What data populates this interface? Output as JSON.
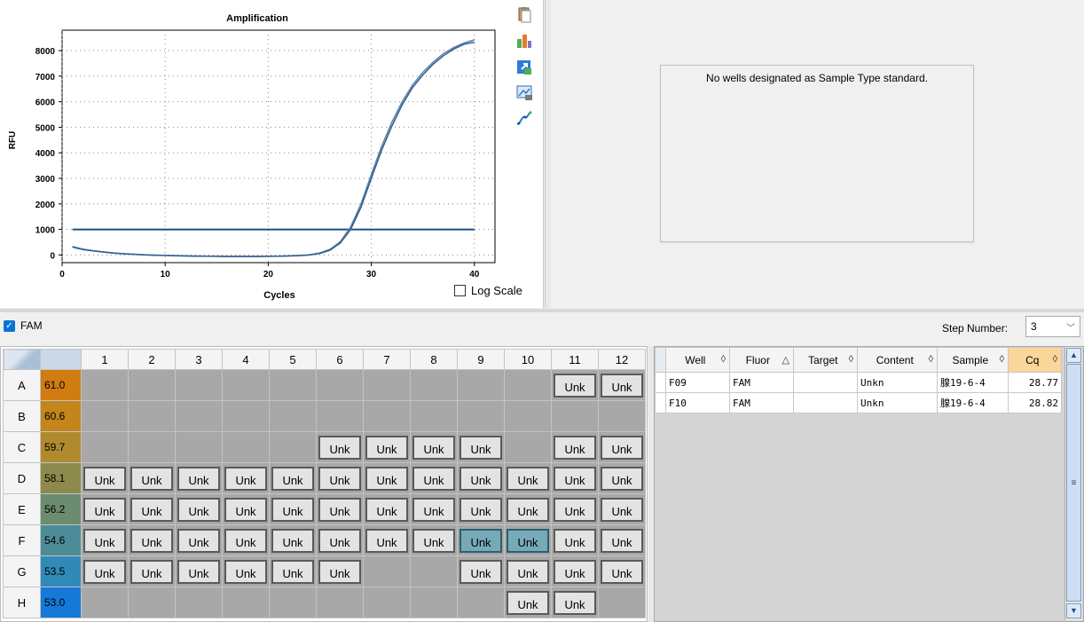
{
  "chart_data": {
    "type": "line",
    "title": "Amplification",
    "xlabel": "Cycles",
    "ylabel": "RFU",
    "xlim": [
      0,
      42
    ],
    "ylim": [
      -300,
      8800
    ],
    "xticks": [
      0,
      10,
      20,
      30,
      40
    ],
    "yticks": [
      0,
      1000,
      2000,
      3000,
      4000,
      5000,
      6000,
      7000,
      8000
    ],
    "grid": true,
    "series": [
      {
        "color": "#5b7fa8",
        "x": [
          1,
          2,
          3,
          4,
          5,
          6,
          7,
          8,
          9,
          10,
          11,
          12,
          13,
          14,
          15,
          16,
          17,
          18,
          19,
          20,
          21,
          22,
          23,
          24,
          25,
          26,
          27,
          28,
          29,
          30,
          31,
          32,
          33,
          34,
          35,
          36,
          37,
          38,
          39,
          40
        ],
        "values": [
          330,
          230,
          170,
          120,
          80,
          50,
          30,
          10,
          -5,
          -15,
          -25,
          -35,
          -40,
          -45,
          -50,
          -55,
          -55,
          -55,
          -55,
          -50,
          -45,
          -35,
          -20,
          10,
          80,
          220,
          520,
          1100,
          2000,
          3150,
          4250,
          5200,
          6000,
          6650,
          7150,
          7550,
          7880,
          8120,
          8300,
          8420
        ]
      },
      {
        "color": "#2f5f8f",
        "x": [
          1,
          2,
          3,
          4,
          5,
          6,
          7,
          8,
          9,
          10,
          11,
          12,
          13,
          14,
          15,
          16,
          17,
          18,
          19,
          20,
          21,
          22,
          23,
          24,
          25,
          26,
          27,
          28,
          29,
          30,
          31,
          32,
          33,
          34,
          35,
          36,
          37,
          38,
          39,
          40
        ],
        "values": [
          310,
          215,
          160,
          115,
          75,
          45,
          25,
          5,
          -10,
          -20,
          -30,
          -40,
          -45,
          -50,
          -55,
          -60,
          -60,
          -60,
          -60,
          -55,
          -50,
          -40,
          -25,
          0,
          60,
          190,
          470,
          1000,
          1870,
          3000,
          4100,
          5050,
          5880,
          6550,
          7050,
          7470,
          7800,
          8060,
          8250,
          8330
        ]
      }
    ],
    "threshold": {
      "value": 1000,
      "color": "#1c4f86",
      "x_start": 1,
      "x_end": 40
    }
  },
  "chart_options": {
    "log_scale_label": "Log Scale",
    "log_scale_checked": false
  },
  "toolbar_icons": [
    "copy-icon",
    "chart-options-icon",
    "export-icon",
    "print-image-icon",
    "curve-fit-icon"
  ],
  "standard_curve": {
    "message": "No wells designated as Sample Type standard."
  },
  "fluor_filter": {
    "label": "FAM",
    "checked": true
  },
  "step": {
    "label": "Step Number:",
    "value": "3"
  },
  "plate": {
    "columns": [
      "1",
      "2",
      "3",
      "4",
      "5",
      "6",
      "7",
      "8",
      "9",
      "10",
      "11",
      "12"
    ],
    "rows": [
      {
        "label": "A",
        "temp": "61.0",
        "temp_color": "#d07c10",
        "wells": [
          "",
          "",
          "",
          "",
          "",
          "",
          "",
          "",
          "",
          "",
          "Unk",
          "Unk"
        ]
      },
      {
        "label": "B",
        "temp": "60.6",
        "temp_color": "#c4851a",
        "wells": [
          "",
          "",
          "",
          "",
          "",
          "",
          "",
          "",
          "",
          "",
          "",
          ""
        ]
      },
      {
        "label": "C",
        "temp": "59.7",
        "temp_color": "#b08a2e",
        "wells": [
          "",
          "",
          "",
          "",
          "",
          "Unk",
          "Unk",
          "Unk",
          "Unk",
          "",
          "Unk",
          "Unk"
        ]
      },
      {
        "label": "D",
        "temp": "58.1",
        "temp_color": "#8c8a4c",
        "wells": [
          "Unk",
          "Unk",
          "Unk",
          "Unk",
          "Unk",
          "Unk",
          "Unk",
          "Unk",
          "Unk",
          "Unk",
          "Unk",
          "Unk"
        ]
      },
      {
        "label": "E",
        "temp": "56.2",
        "temp_color": "#6b8c70",
        "wells": [
          "Unk",
          "Unk",
          "Unk",
          "Unk",
          "Unk",
          "Unk",
          "Unk",
          "Unk",
          "Unk",
          "Unk",
          "Unk",
          "Unk"
        ]
      },
      {
        "label": "F",
        "temp": "54.6",
        "temp_color": "#4c8c98",
        "wells": [
          "Unk",
          "Unk",
          "Unk",
          "Unk",
          "Unk",
          "Unk",
          "Unk",
          "Unk",
          "Unk*",
          "Unk*",
          "Unk",
          "Unk"
        ]
      },
      {
        "label": "G",
        "temp": "53.5",
        "temp_color": "#2f8ab8",
        "wells": [
          "Unk",
          "Unk",
          "Unk",
          "Unk",
          "Unk",
          "Unk",
          "",
          "",
          "Unk",
          "Unk",
          "Unk",
          "Unk"
        ]
      },
      {
        "label": "H",
        "temp": "53.0",
        "temp_color": "#1479d8",
        "wells": [
          "",
          "",
          "",
          "",
          "",
          "",
          "",
          "",
          "",
          "Unk",
          "Unk",
          ""
        ]
      }
    ]
  },
  "results": {
    "headers": [
      {
        "label": "Well",
        "sort": "◊"
      },
      {
        "label": "Fluor",
        "sort": "△"
      },
      {
        "label": "Target",
        "sort": "◊"
      },
      {
        "label": "Content",
        "sort": "◊"
      },
      {
        "label": "Sample",
        "sort": "◊"
      },
      {
        "label": "Cq",
        "sort": "◊"
      }
    ],
    "rows": [
      [
        "F09",
        "FAM",
        "",
        "Unkn",
        "腺19-6-4",
        "28.77"
      ],
      [
        "F10",
        "FAM",
        "",
        "Unkn",
        "腺19-6-4",
        "28.82"
      ]
    ]
  }
}
